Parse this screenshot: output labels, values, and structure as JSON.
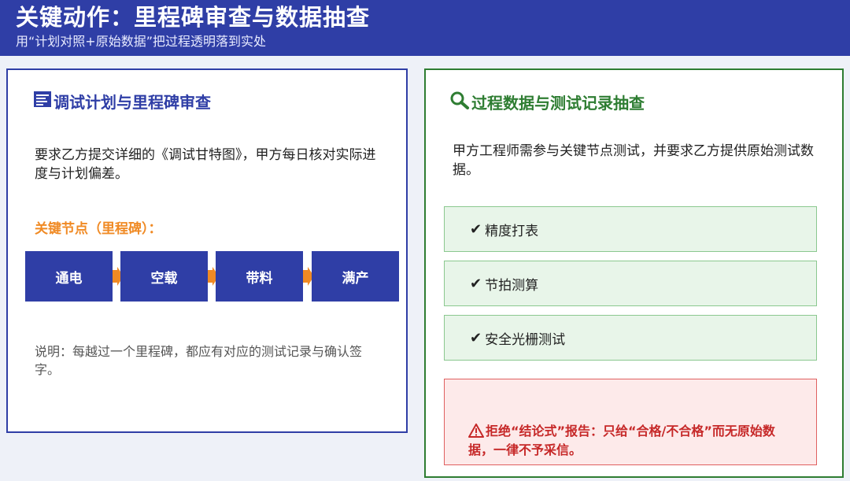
{
  "header": {
    "title": "关键动作：里程碑审查与数据抽查",
    "subtitle": "用“计划对照+原始数据”把过程透明落到实处"
  },
  "left_panel": {
    "icon": "document-icon",
    "title": "调试计划与里程碑审查",
    "body": "要求乙方提交详细的《调试甘特图》，甲方每日核对实际进度与计划偏差。",
    "milestone_label": "关键节点（里程碑）：",
    "milestones": [
      "通电",
      "空载",
      "带料",
      "满产"
    ],
    "note": "说明：每越过一个里程碑，都应有对应的测试记录与确认签字。"
  },
  "right_panel": {
    "icon": "magnifier-icon",
    "title": "过程数据与测试记录抽查",
    "body": "甲方工程师需参与关键节点测试，并要求乙方提供原始测试数据。",
    "check_items": [
      {
        "mark": "✔",
        "label": "精度打表"
      },
      {
        "mark": "✔",
        "label": "节拍测算"
      },
      {
        "mark": "✔",
        "label": "安全光栅测试"
      }
    ],
    "warning_icon": "warning-icon",
    "warning": "拒绝“结论式”报告：只给“合格/不合格”而无原始数据，一律不予采信。"
  },
  "colors": {
    "brand_blue": "#2f3ea6",
    "green": "#2e7d32",
    "orange": "#f08a24",
    "red": "#c62828"
  }
}
